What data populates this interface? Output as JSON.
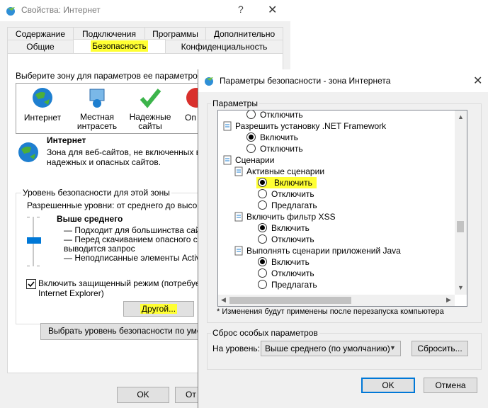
{
  "back": {
    "title": "Свойства: Интернет",
    "help": "?",
    "close": "✕",
    "tabs_top": [
      "Содержание",
      "Подключения",
      "Программы",
      "Дополнительно"
    ],
    "tabs_bottom": [
      "Общие",
      "Безопасность",
      "Конфиденциальность"
    ],
    "zone_prompt": "Выберите зону для параметров ее параметров безо",
    "zones": [
      "Интернет",
      "Местная интрасеть",
      "Надежные сайты",
      "Оп"
    ],
    "zone_heading": "Интернет",
    "zone_desc_line1": "Зона для веб-сайтов, не включенных в з",
    "zone_desc_line2": "надежных и опасных сайтов.",
    "level_group": "Уровень безопасности для этой зоны",
    "allowed_levels": "Разрешенные уровни: от среднего до высоко",
    "level_name": "Выше среднего",
    "level_items": [
      "— Подходит для большинства сайто",
      "— Перед скачиванием опасного соде",
      "выводится запрос",
      "— Неподписанные элементы ActiveX"
    ],
    "protected_mode_line1": "Включить защищенный режим (потребуется",
    "protected_mode_line2": "Internet Explorer)",
    "other_button": "Другой...",
    "default_level_button": "Выбрать уровень безопасности по умолча",
    "ok_button": "OK",
    "cancel_partial": "От"
  },
  "front": {
    "title": "Параметры безопасности - зона Интернета",
    "close": "✕",
    "settings_group": "Параметры",
    "tree": [
      {
        "text": "Отключить",
        "kind": "radio",
        "checked": false,
        "indent": 1
      },
      {
        "text": "Разрешить установку .NET Framework",
        "kind": "cat",
        "indent": 0
      },
      {
        "text": "Включить",
        "kind": "radio",
        "checked": true,
        "indent": 1
      },
      {
        "text": "Отключить",
        "kind": "radio",
        "checked": false,
        "indent": 1
      },
      {
        "text": "Сценарии",
        "kind": "folder",
        "indent": 0
      },
      {
        "text": "Активные сценарии",
        "kind": "cat",
        "indent": 1
      },
      {
        "text": "Включить",
        "kind": "radio",
        "checked": true,
        "indent": 2,
        "highlight": true
      },
      {
        "text": "Отключить",
        "kind": "radio",
        "checked": false,
        "indent": 2
      },
      {
        "text": "Предлагать",
        "kind": "radio",
        "checked": false,
        "indent": 2
      },
      {
        "text": "Включить фильтр XSS",
        "kind": "cat",
        "indent": 1
      },
      {
        "text": "Включить",
        "kind": "radio",
        "checked": true,
        "indent": 2
      },
      {
        "text": "Отключить",
        "kind": "radio",
        "checked": false,
        "indent": 2
      },
      {
        "text": "Выполнять сценарии приложений Java",
        "kind": "cat",
        "indent": 1
      },
      {
        "text": "Включить",
        "kind": "radio",
        "checked": true,
        "indent": 2
      },
      {
        "text": "Отключить",
        "kind": "radio",
        "checked": false,
        "indent": 2
      },
      {
        "text": "Предлагать",
        "kind": "radio",
        "checked": false,
        "indent": 2
      }
    ],
    "restart_note": "* Изменения будут применены после перезапуска компьютера",
    "reset_group": "Сброс особых параметров",
    "reset_to_label": "На уровень:",
    "reset_level_value": "Выше среднего (по умолчанию)",
    "reset_button": "Сбросить...",
    "ok_button": "OK",
    "cancel_button": "Отмена"
  },
  "colors": {
    "highlight": "#ffff33",
    "accent": "#0078d7",
    "check": "#3cb44b",
    "globe": "#1e7fd0"
  }
}
